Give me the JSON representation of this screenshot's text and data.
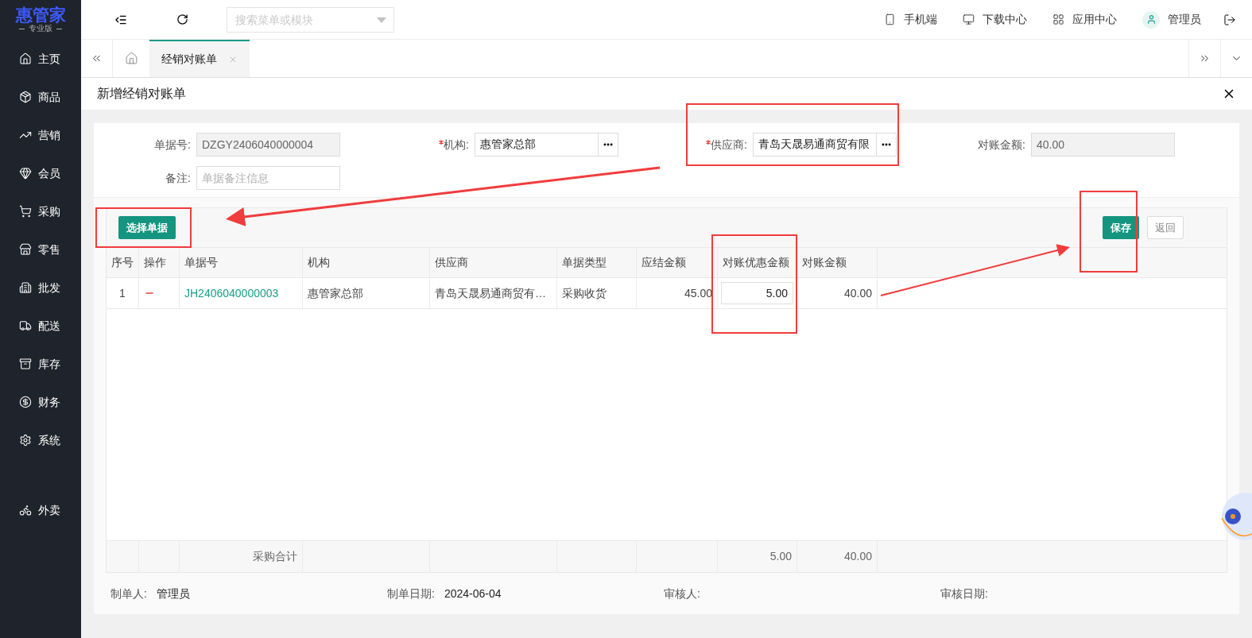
{
  "brand": {
    "name": "惠管家",
    "edition": "专业版"
  },
  "sidebar": {
    "items": [
      {
        "label": "主页"
      },
      {
        "label": "商品"
      },
      {
        "label": "营销"
      },
      {
        "label": "会员"
      },
      {
        "label": "采购"
      },
      {
        "label": "零售"
      },
      {
        "label": "批发"
      },
      {
        "label": "配送"
      },
      {
        "label": "库存"
      },
      {
        "label": "财务"
      },
      {
        "label": "系统"
      },
      {
        "label": "外卖"
      }
    ]
  },
  "topbar": {
    "search": {
      "placeholder": "搜索菜单或模块"
    },
    "links": [
      "手机端",
      "下载中心",
      "应用中心"
    ],
    "user": "管理员"
  },
  "tabs": [
    {
      "label": "经销对账单",
      "selected": true
    }
  ],
  "dialog": {
    "title": "新增经销对账单",
    "fields": [
      {
        "label": "单据号:",
        "value": "DZGY2406040000004",
        "required": false,
        "disabled": true,
        "picker": false
      },
      {
        "label": "机构:",
        "value": "惠管家总部",
        "required": true,
        "disabled": false,
        "picker": true
      },
      {
        "label": "供应商:",
        "value": "青岛天晟易通商贸有限",
        "required": true,
        "disabled": false,
        "picker": true
      },
      {
        "label": "对账金额:",
        "value": "40.00",
        "required": false,
        "disabled": true,
        "picker": false
      },
      {
        "label": "备注:",
        "placeholder": "单据备注信息",
        "required": false,
        "disabled": false,
        "picker": false
      }
    ],
    "select_button": "选择单据",
    "save_button": "保存",
    "back_button": "返回",
    "table": {
      "columns": [
        "序号",
        "操作",
        "单据号",
        "机构",
        "供应商",
        "单据类型",
        "应结金额",
        "对账优惠金额",
        "对账金额"
      ],
      "rows": [
        {
          "index": "1",
          "bill_no": "JH2406040000003",
          "org": "惠管家总部",
          "supplier": "青岛天晟易通商贸有…",
          "type": "采购收货",
          "payable": "45.00",
          "discount": "5.00",
          "amount": "40.00"
        }
      ],
      "total": {
        "label": "采购合计",
        "discount": "5.00",
        "amount": "40.00"
      }
    },
    "footer": [
      {
        "label": "制单人:",
        "value": "管理员"
      },
      {
        "label": "制单日期:",
        "value": "2024-06-04"
      },
      {
        "label": "审核人:"
      },
      {
        "label": "审核日期:"
      }
    ]
  }
}
